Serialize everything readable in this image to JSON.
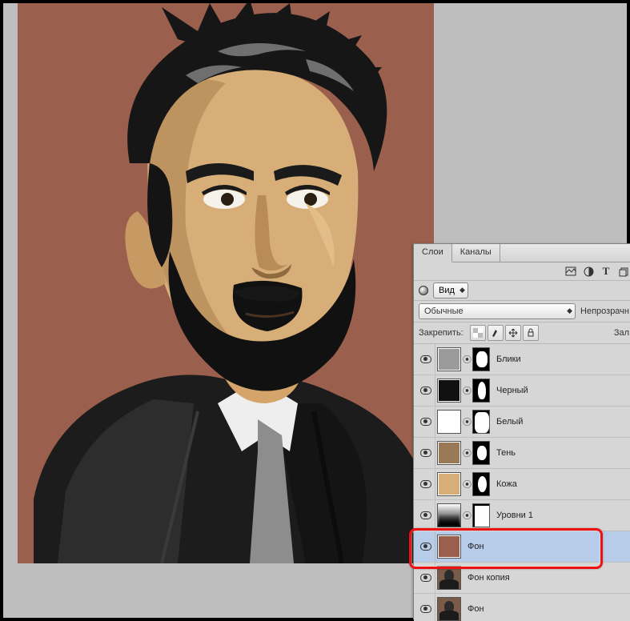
{
  "tabs": {
    "layers": "Слои",
    "channels": "Каналы"
  },
  "iconRow": {
    "img": "image-icon",
    "fx": "fx-icon",
    "type": "T",
    "mask": "mask-icon"
  },
  "viewRow": {
    "label": "Вид"
  },
  "blendRow": {
    "mode": "Обычные",
    "opacityLabel": "Непрозрачн"
  },
  "lockRow": {
    "label": "Закрепить:",
    "fillLabel": "Зал"
  },
  "layers": [
    {
      "name": "Блики",
      "visible": true,
      "thumb": "#9b9b9b",
      "mask": true
    },
    {
      "name": "Черный",
      "visible": true,
      "thumb": "#111111",
      "mask": true
    },
    {
      "name": "Белый",
      "visible": true,
      "thumb": "#ffffff",
      "mask": true
    },
    {
      "name": "Тень",
      "visible": true,
      "thumb": "#9a7a56",
      "mask": true
    },
    {
      "name": "Кожа",
      "visible": true,
      "thumb": "#d7ad78",
      "mask": true
    },
    {
      "name": "Уровни 1",
      "visible": true,
      "adjustment": true,
      "mask": true
    },
    {
      "name": "Фон",
      "visible": true,
      "thumb": "#9b5f4e",
      "selected": true
    },
    {
      "name": "Фон копия",
      "visible": true,
      "photo": true
    },
    {
      "name": "Фон",
      "visible": true,
      "photo": true
    }
  ],
  "annotation": {
    "highlightLayerIndex": 6
  }
}
